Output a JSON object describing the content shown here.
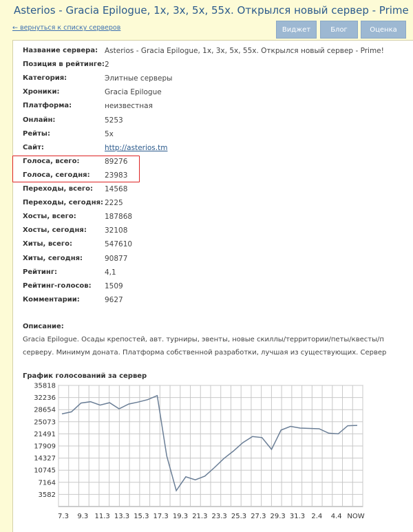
{
  "header": {
    "title": "Asterios - Gracia Epilogue, 1x, 3x, 5x, 55x. Открылся новый сервер - Prime!",
    "back_link": "← вернуться к списку серверов",
    "buttons": [
      "Виджет",
      "Блог",
      "Оценка"
    ]
  },
  "info": [
    {
      "key": "Название сервера:",
      "value": "Asterios - Gracia Epilogue, 1x, 3x, 5x, 55x. Открылся новый сервер - Prime!"
    },
    {
      "key": "Позиция в рейтинге:",
      "value": "2"
    },
    {
      "key": "Категория:",
      "value": "Элитные серверы"
    },
    {
      "key": "Хроники:",
      "value": "Gracia Epilogue"
    },
    {
      "key": "Платформа:",
      "value": "неизвестная"
    },
    {
      "key": "Онлайн:",
      "value": "5253"
    },
    {
      "key": "Рейты:",
      "value": "5x"
    },
    {
      "key": "Сайт:",
      "value": "http://asterios.tm"
    },
    {
      "key": "Голоса, всего:",
      "value": "89276"
    },
    {
      "key": "Голоса, сегодня:",
      "value": "23983"
    },
    {
      "key": "Переходы, всего:",
      "value": "14568"
    },
    {
      "key": "Переходы, сегодня:",
      "value": "2225"
    },
    {
      "key": "Хосты, всего:",
      "value": "187868"
    },
    {
      "key": "Хосты, сегодня:",
      "value": "32108"
    },
    {
      "key": "Хиты, всего:",
      "value": "547610"
    },
    {
      "key": "Хиты, сегодня:",
      "value": "90877"
    },
    {
      "key": "Рейтинг:",
      "value": "4,1"
    },
    {
      "key": "Рейтинг-голосов:",
      "value": "1509"
    },
    {
      "key": "Комментарии:",
      "value": "9627"
    }
  ],
  "description": {
    "label": "Описание:",
    "lines": [
      "Gracia Epilogue. Осады крепостей, авт. турниры, эвенты, новые скиллы/территории/петы/квесты/п",
      "серверу. Минимум доната. Платформа собственной разработки, лучшая из существующих. Сервер"
    ]
  },
  "colors": {
    "background": "#fdfbd6",
    "title": "#2b5a8c",
    "button": "#9db8d2",
    "highlight": "#dd2222",
    "line": "#6a7e96"
  },
  "chart_data": {
    "type": "line",
    "title": "График голосований за сервер",
    "xlabel": "",
    "ylabel": "",
    "yticks": [
      3582,
      7164,
      10745,
      14327,
      17909,
      21491,
      25073,
      28654,
      32236,
      35818
    ],
    "ylim": [
      0,
      35818
    ],
    "xticks": [
      "7.3",
      "9.3",
      "11.3",
      "13.3",
      "15.3",
      "17.3",
      "19.3",
      "21.3",
      "23.3",
      "25.3",
      "27.3",
      "29.3",
      "31.3",
      "2.4",
      "4.4",
      "NOW"
    ],
    "grid": true,
    "series": [
      {
        "name": "",
        "values": [
          27400,
          28000,
          30600,
          31000,
          30000,
          30700,
          28900,
          30300,
          30900,
          31600,
          32800,
          15000,
          4700,
          8800,
          7900,
          9000,
          11500,
          14200,
          16400,
          18900,
          20700,
          20400,
          16900,
          22600,
          23700,
          23200,
          23100,
          23000,
          21700,
          21500,
          23900,
          24000
        ]
      }
    ]
  }
}
